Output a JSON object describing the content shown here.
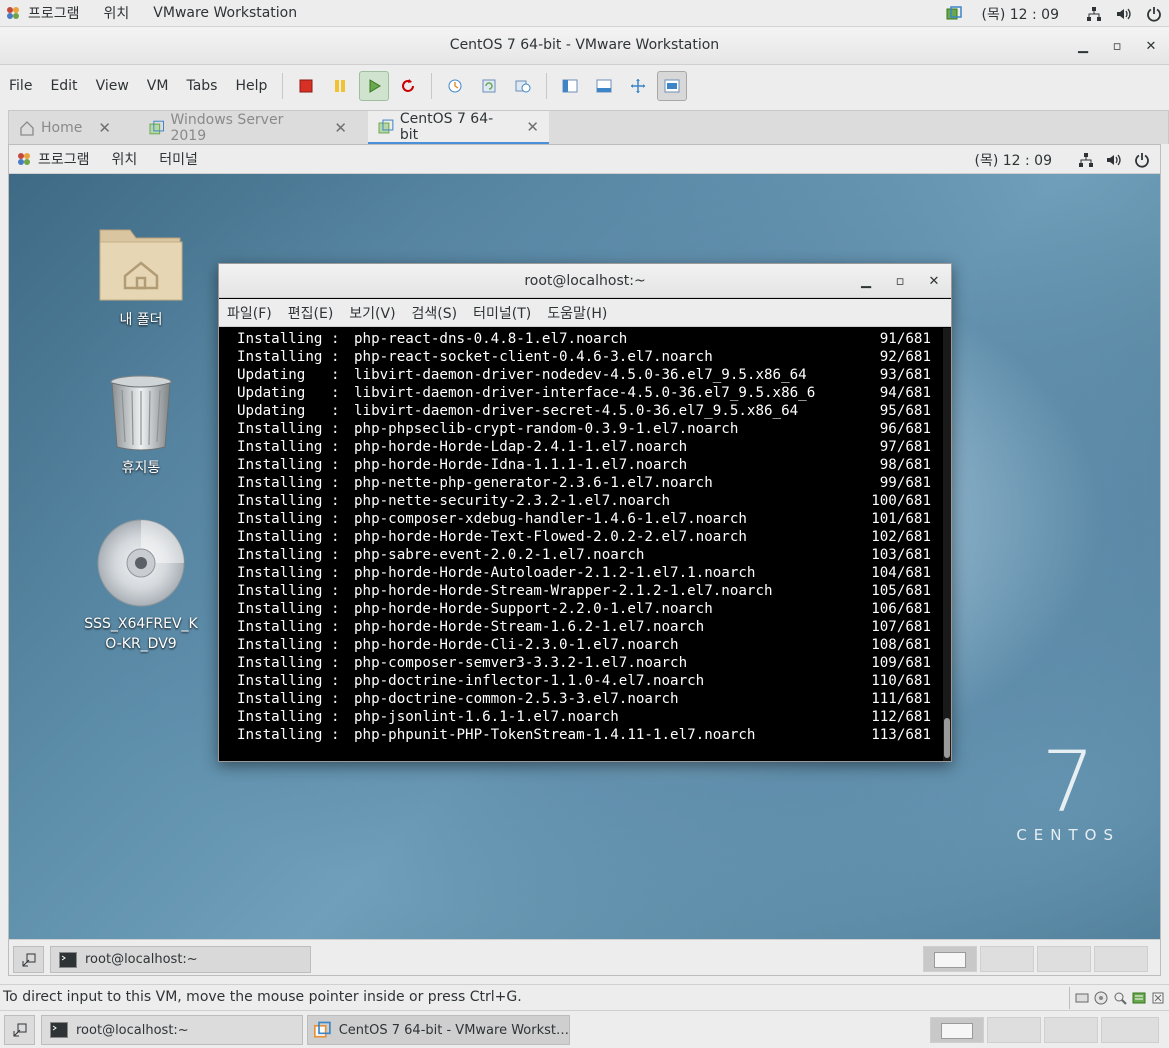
{
  "host_panel": {
    "apps": "프로그램",
    "places": "위치",
    "app_name": "VMware Workstation",
    "clock": "(목) 12 : 09"
  },
  "vmware": {
    "window_title": "CentOS 7 64-bit - VMware Workstation",
    "menus": [
      "File",
      "Edit",
      "View",
      "VM",
      "Tabs",
      "Help"
    ],
    "tabs": [
      {
        "label": "Home",
        "active": false
      },
      {
        "label": "Windows Server 2019",
        "active": false
      },
      {
        "label": "CentOS 7 64-bit",
        "active": true
      }
    ],
    "status_message": "To direct input to this VM, move the mouse pointer inside or press Ctrl+G."
  },
  "guest": {
    "panel": {
      "apps": "프로그램",
      "places": "위치",
      "terminal": "터미널",
      "clock": "(목) 12 : 09"
    },
    "desktop_icons": {
      "home": "내 폴더",
      "trash": "휴지통",
      "disc": "SSS_X64FREV_KO-KR_DV9"
    },
    "brand": {
      "seven": "7",
      "word": "CENTOS"
    },
    "taskbar_window": "root@localhost:~"
  },
  "terminal": {
    "title": "root@localhost:~",
    "menus": [
      "파일(F)",
      "편집(E)",
      "보기(V)",
      "검색(S)",
      "터미널(T)",
      "도움말(H)"
    ],
    "lines": [
      {
        "action": "Installing :",
        "package": "php-react-dns-0.4.8-1.el7.noarch",
        "count": "91/681"
      },
      {
        "action": "Installing :",
        "package": "php-react-socket-client-0.4.6-3.el7.noarch",
        "count": "92/681"
      },
      {
        "action": "Updating   :",
        "package": "libvirt-daemon-driver-nodedev-4.5.0-36.el7_9.5.x86_64",
        "count": "93/681"
      },
      {
        "action": "Updating   :",
        "package": "libvirt-daemon-driver-interface-4.5.0-36.el7_9.5.x86_6",
        "count": "94/681"
      },
      {
        "action": "Updating   :",
        "package": "libvirt-daemon-driver-secret-4.5.0-36.el7_9.5.x86_64",
        "count": "95/681"
      },
      {
        "action": "Installing :",
        "package": "php-phpseclib-crypt-random-0.3.9-1.el7.noarch",
        "count": "96/681"
      },
      {
        "action": "Installing :",
        "package": "php-horde-Horde-Ldap-2.4.1-1.el7.noarch",
        "count": "97/681"
      },
      {
        "action": "Installing :",
        "package": "php-horde-Horde-Idna-1.1.1-1.el7.noarch",
        "count": "98/681"
      },
      {
        "action": "Installing :",
        "package": "php-nette-php-generator-2.3.6-1.el7.noarch",
        "count": "99/681"
      },
      {
        "action": "Installing :",
        "package": "php-nette-security-2.3.2-1.el7.noarch",
        "count": "100/681"
      },
      {
        "action": "Installing :",
        "package": "php-composer-xdebug-handler-1.4.6-1.el7.noarch",
        "count": "101/681"
      },
      {
        "action": "Installing :",
        "package": "php-horde-Horde-Text-Flowed-2.0.2-2.el7.noarch",
        "count": "102/681"
      },
      {
        "action": "Installing :",
        "package": "php-sabre-event-2.0.2-1.el7.noarch",
        "count": "103/681"
      },
      {
        "action": "Installing :",
        "package": "php-horde-Horde-Autoloader-2.1.2-1.el7.1.noarch",
        "count": "104/681"
      },
      {
        "action": "Installing :",
        "package": "php-horde-Horde-Stream-Wrapper-2.1.2-1.el7.noarch",
        "count": "105/681"
      },
      {
        "action": "Installing :",
        "package": "php-horde-Horde-Support-2.2.0-1.el7.noarch",
        "count": "106/681"
      },
      {
        "action": "Installing :",
        "package": "php-horde-Horde-Stream-1.6.2-1.el7.noarch",
        "count": "107/681"
      },
      {
        "action": "Installing :",
        "package": "php-horde-Horde-Cli-2.3.0-1.el7.noarch",
        "count": "108/681"
      },
      {
        "action": "Installing :",
        "package": "php-composer-semver3-3.3.2-1.el7.noarch",
        "count": "109/681"
      },
      {
        "action": "Installing :",
        "package": "php-doctrine-inflector-1.1.0-4.el7.noarch",
        "count": "110/681"
      },
      {
        "action": "Installing :",
        "package": "php-doctrine-common-2.5.3-3.el7.noarch",
        "count": "111/681"
      },
      {
        "action": "Installing :",
        "package": "php-jsonlint-1.6.1-1.el7.noarch",
        "count": "112/681"
      },
      {
        "action": "Installing :",
        "package": "php-phpunit-PHP-TokenStream-1.4.11-1.el7.noarch",
        "count": "113/681"
      }
    ]
  },
  "host_taskbar": {
    "items": [
      {
        "label": "root@localhost:~"
      },
      {
        "label": "CentOS 7 64-bit - VMware Workst…"
      }
    ]
  },
  "icons": {
    "apps": "apps-icon",
    "network": "network-icon",
    "volume": "volume-icon",
    "power": "power-icon",
    "vmware": "vmware-icon",
    "home": "home-icon",
    "vm": "vm-icon",
    "terminal": "terminal-icon"
  },
  "colors": {
    "accent": "#4a90d9",
    "terminal_bg": "#000000",
    "terminal_fg": "#ffffff"
  }
}
